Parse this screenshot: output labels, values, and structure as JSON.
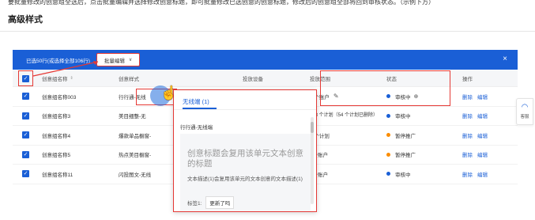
{
  "caption": "要批量修改的创意组全选后，点击批量编辑并选择修改创意标题，即可批量修改已选创意的创意标题，修改后的创意组全部将回到审核状态。（示例下方）",
  "page_title": "高级样式",
  "batch_bar": {
    "selected_text": "已选50行(或选择全部106行)",
    "batch_edit_label": "批量编辑",
    "close_label": "×"
  },
  "table": {
    "headers": {
      "name": "创意组名称",
      "style": "创意样式",
      "device": "投放设备",
      "range": "投放范围",
      "status": "状态",
      "op": "操作"
    },
    "rows": [
      {
        "name": "创意组名称003",
        "style": "行行通-无线",
        "range": "1 个账户",
        "status": "审核中",
        "status_color": "#1a5fd6",
        "op1": "删除",
        "op2": "编辑"
      },
      {
        "name": "创意组名称3",
        "style": "美目细整-无",
        "range": "408 个计划（54 个计划已删除）",
        "status": "审核中",
        "status_color": "#1a5fd6",
        "op1": "删除",
        "op2": "编辑"
      },
      {
        "name": "创意组名称4",
        "style": "爆款单品橱窗-",
        "range": "1 个计划",
        "status": "暂停推广",
        "status_color": "#fb8c00",
        "op1": "删除",
        "op2": "编辑"
      },
      {
        "name": "创意组名称5",
        "style": "热点美目橱窗-",
        "range": "1个账户",
        "status": "暂停推广",
        "status_color": "#fb8c00",
        "op1": "删除",
        "op2": "编辑"
      },
      {
        "name": "创意组名称11",
        "style": "闪投图文-无线",
        "range": "1个账户",
        "status": "审核中",
        "status_color": "#1a5fd6",
        "op1": "删除",
        "op2": "编辑"
      }
    ]
  },
  "popover": {
    "tab_label": "无线端 (1)",
    "sub_label": "行行通-无线端",
    "headline": "创意标题会复用该单元文本创意的标题",
    "description": "文本描述(1)会复用该单元的文本创意的文本描述(1)",
    "tag_prefix": "标签1:",
    "tag_value": "更新了吗"
  },
  "side_float": {
    "label": "客服"
  }
}
